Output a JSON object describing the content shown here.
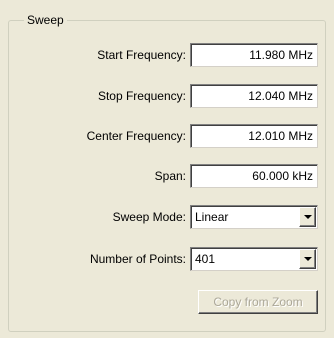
{
  "group": {
    "title": "Sweep"
  },
  "fields": {
    "start_frequency": {
      "label": "Start Frequency:",
      "value": "11.980 MHz"
    },
    "stop_frequency": {
      "label": "Stop Frequency:",
      "value": "12.040 MHz"
    },
    "center_frequency": {
      "label": "Center Frequency:",
      "value": "12.010 MHz"
    },
    "span": {
      "label": "Span:",
      "value": "60.000 kHz"
    },
    "sweep_mode": {
      "label": "Sweep Mode:",
      "value": "Linear"
    },
    "number_of_points": {
      "label": "Number of Points:",
      "value": "401"
    }
  },
  "actions": {
    "copy_from_zoom": {
      "label": "Copy from Zoom",
      "enabled": false
    }
  },
  "icons": {
    "dropdown": "chevron-down-icon"
  },
  "colors": {
    "panel_background": "#ece9d8",
    "disabled_text": "#aca899"
  }
}
